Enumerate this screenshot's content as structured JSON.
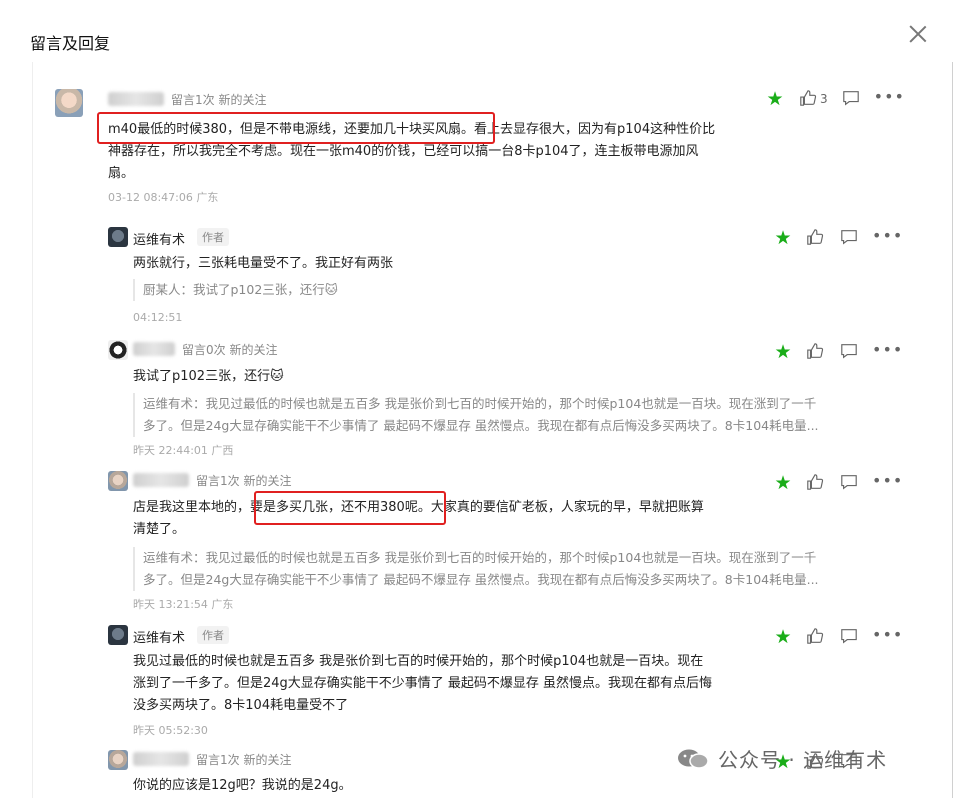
{
  "header": {
    "title": "留言及回复",
    "close_label": ""
  },
  "comments": [
    {
      "meta": "留言1次 新的关注",
      "line1": "m40最低的时候380，但是不带电源线，还要加几十块买风扇。看上去显存很大，因为有p104这种性价比",
      "line2": "神器存在，所以我完全不考虑。现在一张m40的价钱，已经可以搞一台8卡p104了，连主板带电源加风",
      "line3": "扇。",
      "time": "03-12 08:47:06 广东",
      "likes": "3"
    },
    {
      "name": "运维有术",
      "tag": "作者",
      "text": "两张就行，三张耗电量受不了。我正好有两张",
      "quote": "厨某人：我试了p102三张，还行",
      "emoji": "🐱",
      "time": "04:12:51"
    },
    {
      "meta": "留言0次 新的关注",
      "text": "我试了p102三张，还行",
      "emoji": "🐱",
      "quote1": "运维有术：我见过最低的时候也就是五百多 我是张价到七百的时候开始的，那个时候p104也就是一百块。现在涨到了一千",
      "quote2": "多了。但是24g大显存确实能干不少事情了 最起码不爆显存 虽然慢点。我现在都有点后悔没多买两块了。8卡104耗电量...",
      "time": "昨天 22:44:01 广西"
    },
    {
      "meta": "留言1次 新的关注",
      "line1": "店是我这里本地的，要是多买几张，还不用380呢。大家真的要信矿老板，人家玩的早，早就把账算",
      "line2": "清楚了。",
      "quote1": "运维有术：我见过最低的时候也就是五百多 我是张价到七百的时候开始的，那个时候p104也就是一百块。现在涨到了一千",
      "quote2": "多了。但是24g大显存确实能干不少事情了 最起码不爆显存 虽然慢点。我现在都有点后悔没多买两块了。8卡104耗电量...",
      "time": "昨天 13:21:54 广东"
    },
    {
      "name": "运维有术",
      "tag": "作者",
      "line1": "我见过最低的时候也就是五百多 我是张价到七百的时候开始的，那个时候p104也就是一百块。现在",
      "line2": "涨到了一千多了。但是24g大显存确实能干不少事情了 最起码不爆显存 虽然慢点。我现在都有点后悔",
      "line3": "没多买两块了。8卡104耗电量受不了",
      "time": "昨天 05:52:30"
    },
    {
      "meta": "留言1次 新的关注",
      "text": "你说的应该是12g吧？我说的是24g。"
    }
  ],
  "watermark": {
    "text": "公众号 · 运维有术"
  },
  "colors": {
    "accent": "#1aad19",
    "highlight": "#e02020"
  }
}
